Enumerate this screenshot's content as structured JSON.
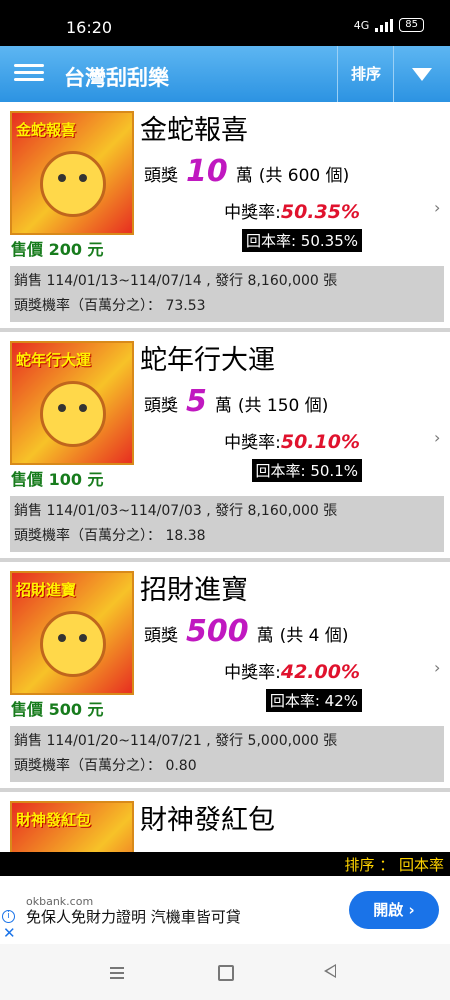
{
  "status": {
    "time": "16:20",
    "network": "4G",
    "battery": "85"
  },
  "appbar": {
    "title": "台灣刮刮樂",
    "sort_label": "排序"
  },
  "cards": [
    {
      "thumb_text": "金蛇報喜",
      "name": "金蛇報喜",
      "prize_label": "頭獎",
      "prize_value": "10",
      "prize_unit": "萬",
      "prize_count": "(共 600 個)",
      "win_label": "中獎率:",
      "win_rate": "50.35%",
      "return_rate": "回本率: 50.35%",
      "price": "售價 200 元",
      "sales": "銷售 114/01/13~114/07/14 , 發行 8,160,000 張",
      "odds": "頭獎機率（百萬分之）： 73.53"
    },
    {
      "thumb_text": "蛇年行大運",
      "name": "蛇年行大運",
      "prize_label": "頭獎",
      "prize_value": "5",
      "prize_unit": "萬",
      "prize_count": "(共 150 個)",
      "win_label": "中獎率:",
      "win_rate": "50.10%",
      "return_rate": "回本率: 50.1%",
      "price": "售價 100 元",
      "sales": "銷售 114/01/03~114/07/03 , 發行 8,160,000 張",
      "odds": "頭獎機率（百萬分之）： 18.38"
    },
    {
      "thumb_text": "招財進寶",
      "name": "招財進寶",
      "prize_label": "頭獎",
      "prize_value": "500",
      "prize_unit": "萬",
      "prize_count": "(共 4 個)",
      "win_label": "中獎率:",
      "win_rate": "42.00%",
      "return_rate": "回本率: 42%",
      "price": "售價 500 元",
      "sales": "銷售 114/01/20~114/07/21 , 發行 5,000,000 張",
      "odds": "頭獎機率（百萬分之）： 0.80"
    },
    {
      "thumb_text": "財神發紅包",
      "name": "財神發紅包",
      "prize_label": "",
      "prize_value": "",
      "prize_unit": "",
      "prize_count": "",
      "win_label": "",
      "win_rate": "",
      "return_rate": "",
      "price": "",
      "sales": "",
      "odds": ""
    }
  ],
  "sort_bar": {
    "text": "排序 ： 回本率"
  },
  "ad": {
    "domain": "okbank.com",
    "text": "免保人免財力證明 汽機車皆可貸",
    "button": "開啟 ›"
  },
  "icons": {
    "menu": "hamburger-icon",
    "dropdown": "triangle-down-icon",
    "chevron": "chevron-right-icon",
    "ad_info": "info-icon",
    "ad_close": "close-icon"
  }
}
